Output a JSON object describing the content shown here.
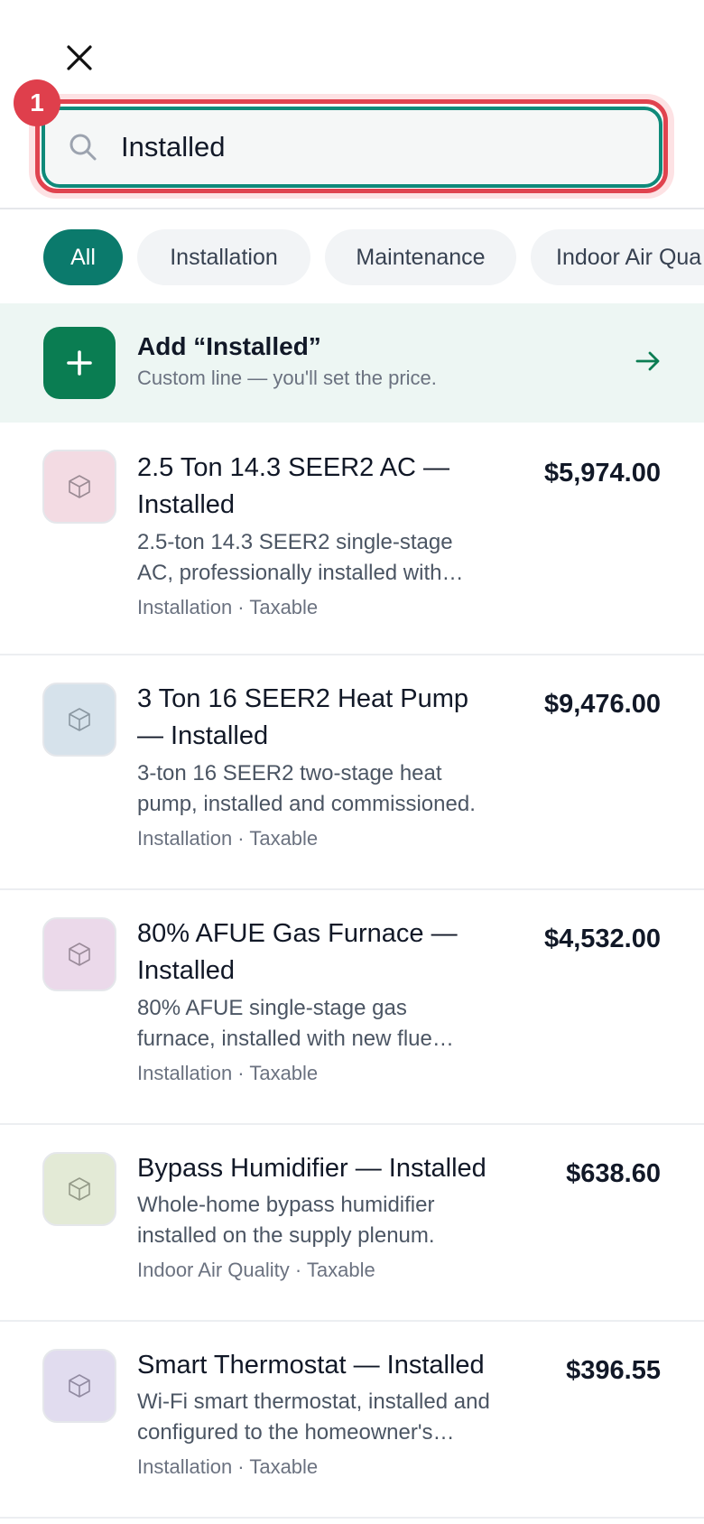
{
  "search": {
    "value": "Installed",
    "annotation_number": "1"
  },
  "icons": {
    "close": "close-icon",
    "search": "search-icon",
    "add": "plus-icon",
    "arrow": "arrow-right-icon",
    "item": "package-icon"
  },
  "colors": {
    "accent": "#0b7a6c",
    "add_button": "#0a7d52",
    "highlight_border": "#e0434f"
  },
  "filters": [
    {
      "label": "All",
      "active": true
    },
    {
      "label": "Installation",
      "active": false
    },
    {
      "label": "Maintenance",
      "active": false
    },
    {
      "label": "Indoor Air Qua",
      "active": false
    }
  ],
  "add_custom": {
    "title": "Add “Installed”",
    "subtitle": "Custom line — you'll set the price."
  },
  "items": [
    {
      "name_line1": "2.5 Ton 14.3 SEER2 AC —",
      "name_line2": "Installed",
      "desc_line1": "2.5-ton 14.3 SEER2 single-stage",
      "desc_line2": "AC, professionally installed with…",
      "meta": "Installation · Taxable",
      "price": "$5,974.00",
      "thumb_color": "#f3dbe3"
    },
    {
      "name_line1": "3 Ton 16 SEER2 Heat Pump",
      "name_line2": "— Installed",
      "desc_line1": "3-ton 16 SEER2 two-stage heat",
      "desc_line2": "pump, installed and commissioned.",
      "meta": "Installation · Taxable",
      "price": "$9,476.00",
      "thumb_color": "#d6e2eb"
    },
    {
      "name_line1": "80% AFUE Gas Furnace —",
      "name_line2": "Installed",
      "desc_line1": "80% AFUE single-stage gas",
      "desc_line2": "furnace, installed with new flue…",
      "meta": "Installation · Taxable",
      "price": "$4,532.00",
      "thumb_color": "#ebd9ea"
    },
    {
      "name_line1": "Bypass Humidifier — Installed",
      "name_line2": "",
      "desc_line1": "Whole-home bypass humidifier",
      "desc_line2": "installed on the supply plenum.",
      "meta": "Indoor Air Quality · Taxable",
      "price": "$638.60",
      "thumb_color": "#e3ead6"
    },
    {
      "name_line1": "Smart Thermostat — Installed",
      "name_line2": "",
      "desc_line1": "Wi-Fi smart thermostat, installed and",
      "desc_line2": "configured to the homeowner's…",
      "meta": "Installation · Taxable",
      "price": "$396.55",
      "thumb_color": "#e1dcef"
    }
  ]
}
